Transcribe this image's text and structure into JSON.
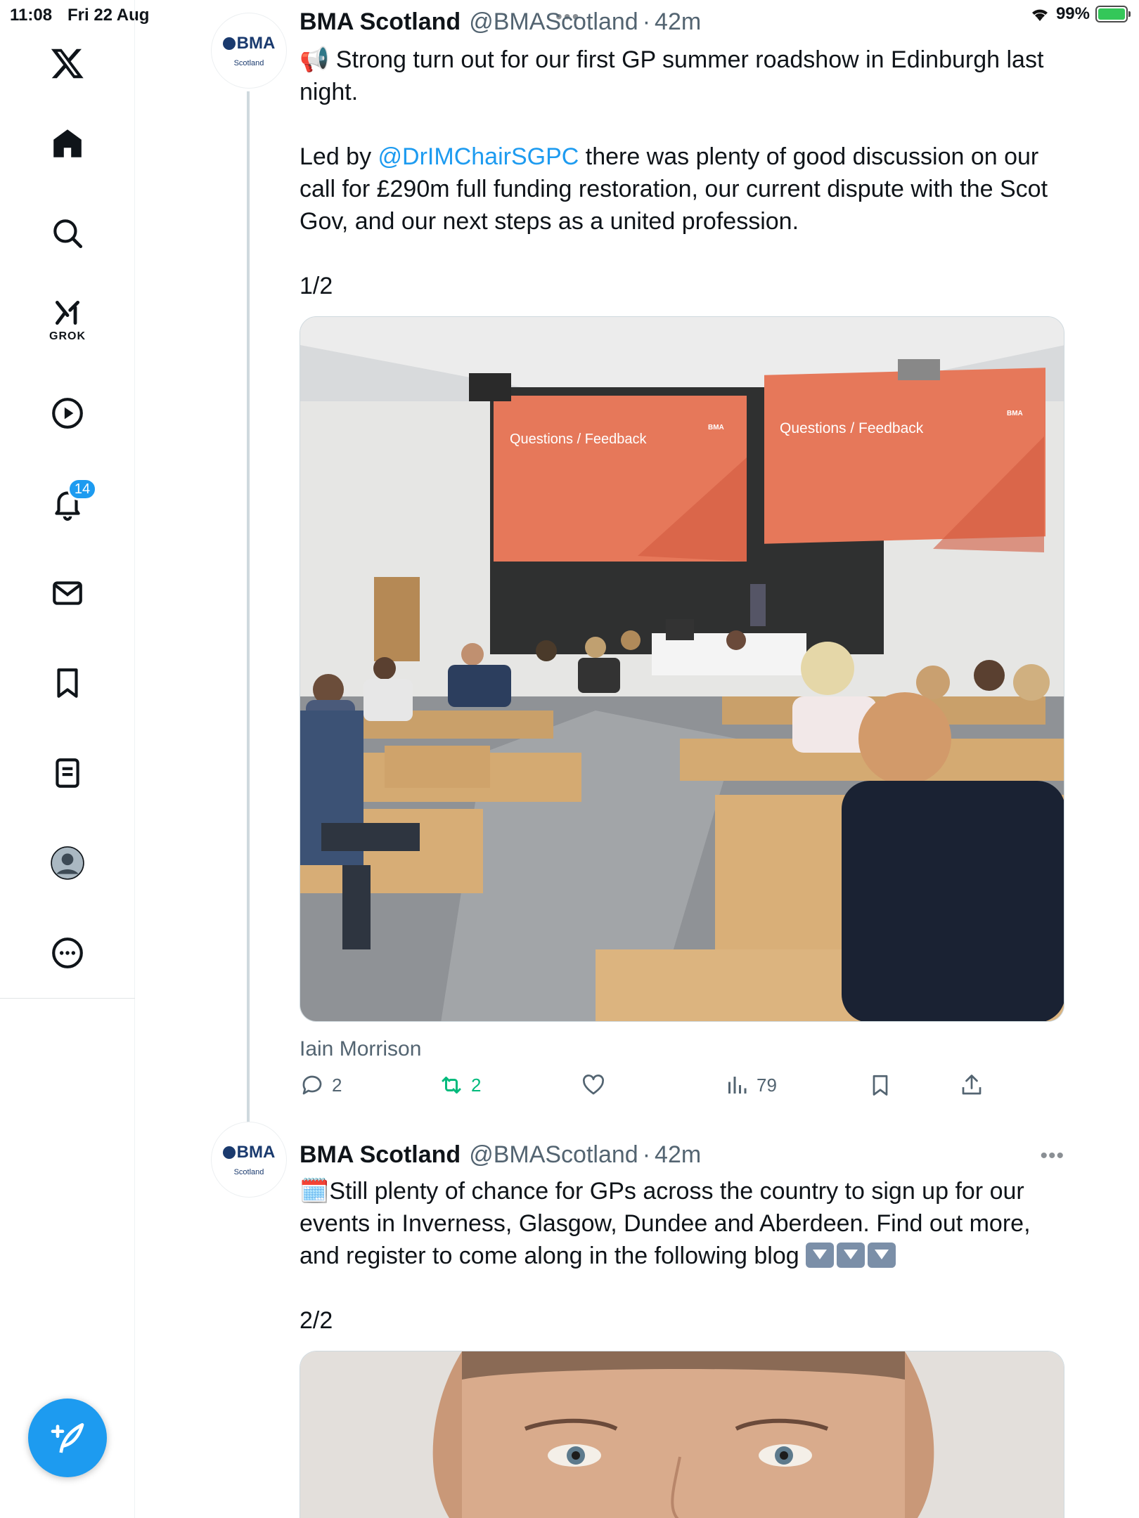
{
  "status_bar": {
    "time": "11:08",
    "date": "Fri 22 Aug",
    "battery": "99%"
  },
  "sidebar": {
    "items": [
      {
        "name": "x-logo-icon"
      },
      {
        "name": "home-icon"
      },
      {
        "name": "search-icon"
      },
      {
        "name": "grok-icon",
        "label": "GROK"
      },
      {
        "name": "video-icon"
      },
      {
        "name": "notifications-icon",
        "badge": "14"
      },
      {
        "name": "messages-icon"
      },
      {
        "name": "bookmarks-icon"
      },
      {
        "name": "lists-icon"
      },
      {
        "name": "profile-icon"
      },
      {
        "name": "more-icon"
      }
    ],
    "compose_icon": "compose-icon"
  },
  "tweets": [
    {
      "avatar_logo": "BMA",
      "avatar_sub": "Scotland",
      "name": "BMA Scotland",
      "handle": "@BMAScotland",
      "sep": "·",
      "time": "42m",
      "text_line1": "📢 Strong turn out for our first GP summer roadshow in Edinburgh last night.",
      "text_led_by": "Led by ",
      "mention": "@DrIMChairSGPC",
      "text_rest": " there was plenty of good discussion on our call for £290m full funding restoration, our current dispute with the Scot Gov, and our next steps as a united profession.",
      "counter": "1/2",
      "slide_title": "Questions / Feedback",
      "slide_brand": "BMA",
      "photo_credit": "Iain Morrison",
      "replies": "2",
      "reposts": "2",
      "views": "79"
    },
    {
      "avatar_logo": "BMA",
      "avatar_sub": "Scotland",
      "name": "BMA Scotland",
      "handle": "@BMAScotland",
      "sep": "·",
      "time": "42m",
      "text": "🗓️Still plenty of chance for GPs across the country to sign up for our events in Inverness, Glasgow, Dundee and Aberdeen. Find out more, and register to come along in the following blog ",
      "counter": "2/2"
    }
  ],
  "colors": {
    "accent": "#1d9bf0",
    "repost": "#00ba7c",
    "muted": "#536471"
  }
}
